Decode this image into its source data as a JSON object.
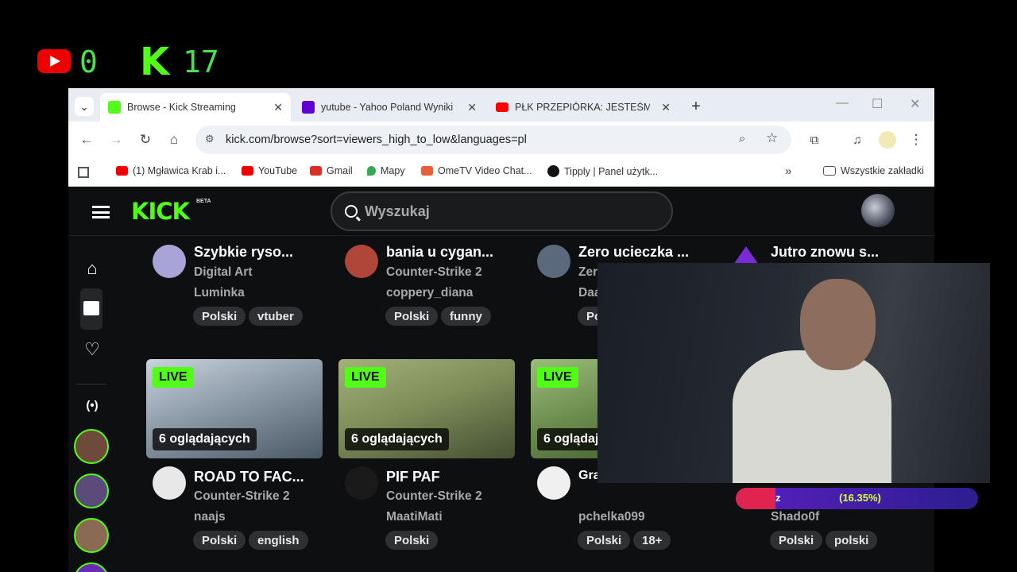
{
  "overlay": {
    "youtube_count": "0",
    "kick_logo": "K",
    "kick_count": "17"
  },
  "browser": {
    "tabs": [
      {
        "title": "Browse - Kick Streaming",
        "icon": "kick-favicon",
        "color": "#53fc18"
      },
      {
        "title": "yutube - Yahoo Poland Wyniki wyszukiwania",
        "icon": "yahoo-favicon",
        "color": "#6001d2"
      },
      {
        "title": "PŁK PRZEPIÓRKA: JESTEŚMY W",
        "icon": "youtube-favicon",
        "color": "#ff0000"
      }
    ],
    "url": "kick.com/browse?sort=viewers_high_to_low&languages=pl",
    "bookmarks": [
      {
        "label": "(1) Mgławica Krab i...",
        "color": "#e00"
      },
      {
        "label": "YouTube",
        "color": "#e00"
      },
      {
        "label": "Gmail",
        "color": "#d93025"
      },
      {
        "label": "Mapy",
        "color": "#34a853"
      },
      {
        "label": "OmeTV Video Chat...",
        "color": "#e85d3a"
      },
      {
        "label": "Tipply | Panel użytk...",
        "color": "#111"
      }
    ],
    "all_bookmarks": "Wszystkie zakładki"
  },
  "kick": {
    "logo": "KICK",
    "beta": "BETA",
    "search_placeholder": "Wyszukaj",
    "accent": "#53fc18",
    "top_cards": [
      {
        "title": "Szybkie ryso...",
        "category": "Digital Art",
        "channel": "Luminka",
        "tags": [
          "Polski",
          "vtuber"
        ],
        "avatar": "#a9a4d8"
      },
      {
        "title": "bania u cygan...",
        "category": "Counter-Strike 2",
        "channel": "coppery_diana",
        "tags": [
          "Polski",
          "funny"
        ],
        "avatar": "#b0463a"
      },
      {
        "title": "Zero ucieczka ...",
        "category": "Zer",
        "channel": "Daa",
        "tags": [
          "Po"
        ],
        "avatar": "#5a6a7c"
      },
      {
        "title": "Jutro znowu s...",
        "category": "",
        "channel": "",
        "tags": [],
        "avatar": "#7a2bd6"
      }
    ],
    "bottom_cards": [
      {
        "live": "LIVE",
        "viewers": "6 oglądających",
        "title": "ROAD TO FAC...",
        "category": "Counter-Strike 2",
        "channel": "naajs",
        "tags": [
          "Polski",
          "english"
        ],
        "avatar": "#e8e8e8",
        "thumb": "#9aa6b3"
      },
      {
        "live": "LIVE",
        "viewers": "6 oglądających",
        "title": "PIF PAF",
        "category": "Counter-Strike 2",
        "channel": "MaatiMati",
        "tags": [
          "Polski"
        ],
        "avatar": "#1a1a1a",
        "thumb": "#8c9a6e"
      },
      {
        "live": "LIVE",
        "viewers": "6 oglądaj",
        "title": "Grand Theft Auto ...",
        "category": "",
        "channel": "pchelka099",
        "tags": [
          "Polski",
          "18+"
        ],
        "avatar": "#f0f0f0",
        "thumb": "#6c8c4e"
      },
      {
        "title": "",
        "category": "",
        "channel": "Shado0f",
        "tags": [
          "Polski",
          "polski"
        ]
      }
    ]
  },
  "donation_goal": {
    "text_z": "z",
    "percent_text": "(16.35%)",
    "progress": 0.1635
  }
}
